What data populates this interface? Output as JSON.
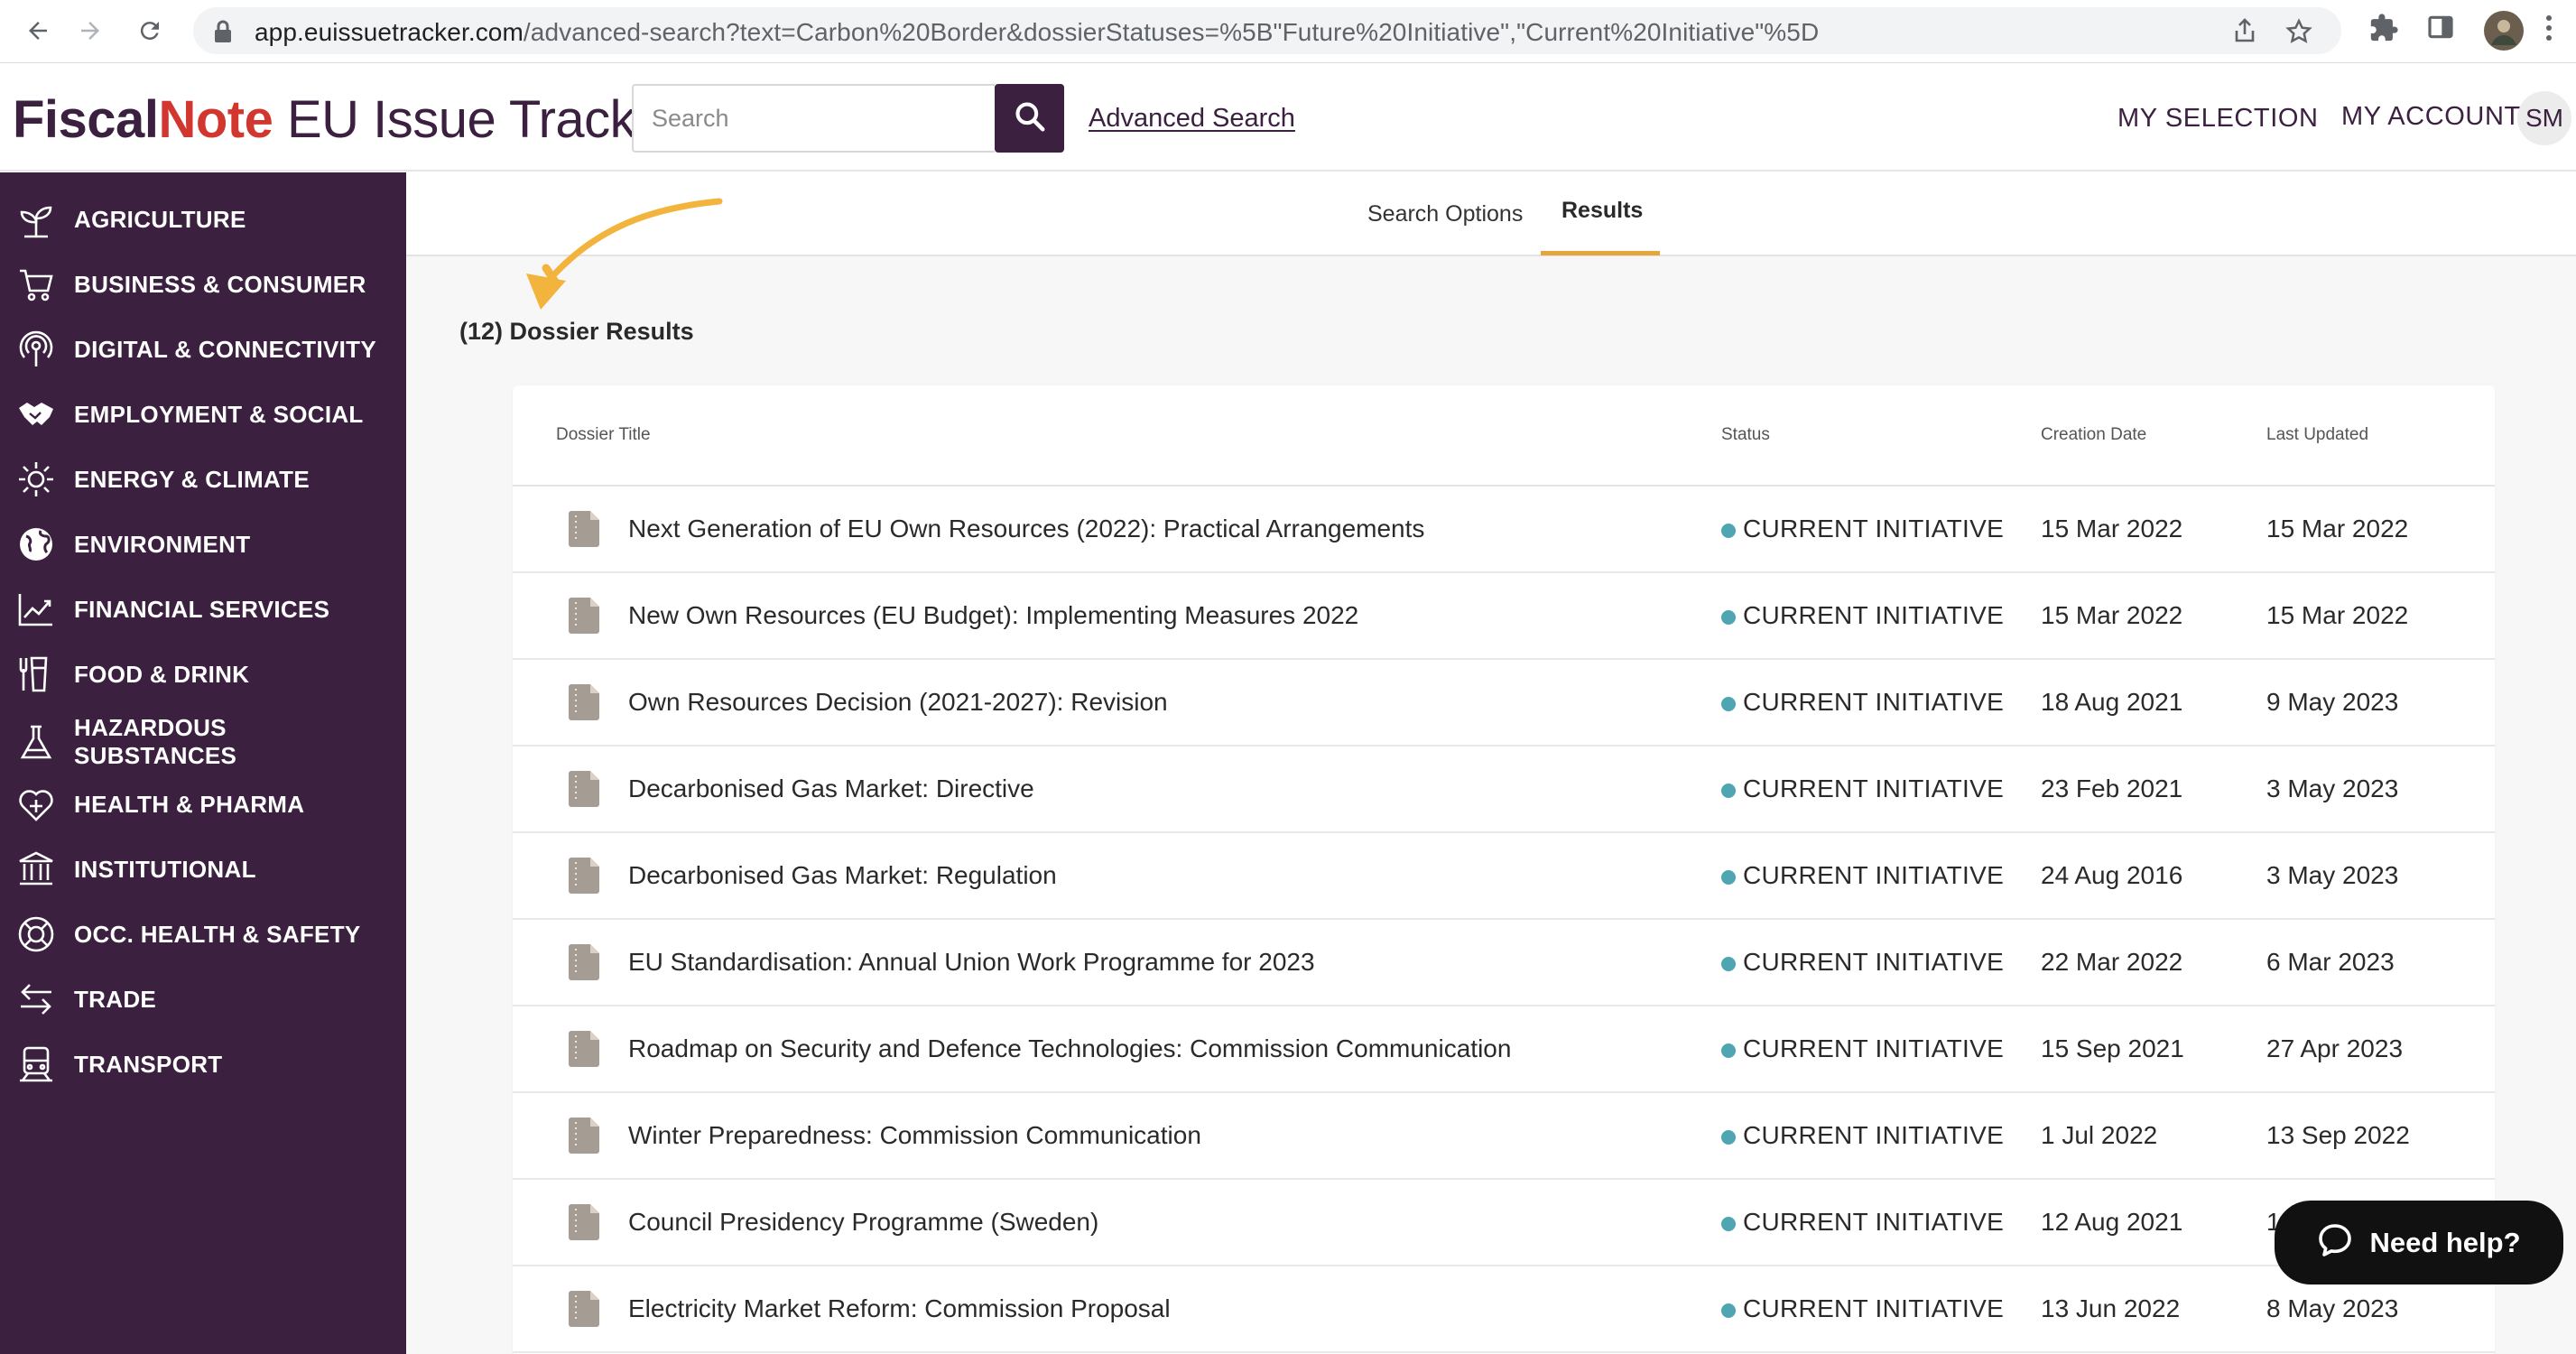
{
  "browser": {
    "url_host": "app.euissuetracker.com",
    "url_path": "/advanced-search?text=Carbon%20Border&dossierStatuses=%5B\"Future%20Initiative\",\"Current%20Initiative\"%5D"
  },
  "header": {
    "logo_brand_part1": "Fiscal",
    "logo_brand_part2": "Note",
    "logo_product": " EU Issue Tracker",
    "search_placeholder": "Search",
    "advanced_search": "Advanced Search",
    "my_selection": "MY SELECTION",
    "my_account": "MY ACCOUNT",
    "avatar_initials": "SM"
  },
  "sidebar": {
    "items": [
      {
        "label": "AGRICULTURE",
        "icon": "sprout-icon"
      },
      {
        "label": "BUSINESS & CONSUMER",
        "icon": "cart-icon"
      },
      {
        "label": "DIGITAL & CONNECTIVITY",
        "icon": "broadcast-icon"
      },
      {
        "label": "EMPLOYMENT & SOCIAL",
        "icon": "handshake-icon"
      },
      {
        "label": "ENERGY & CLIMATE",
        "icon": "sun-icon"
      },
      {
        "label": "ENVIRONMENT",
        "icon": "globe-icon"
      },
      {
        "label": "FINANCIAL SERVICES",
        "icon": "chart-icon"
      },
      {
        "label": "FOOD & DRINK",
        "icon": "utensils-icon"
      },
      {
        "label": "HAZARDOUS\nSUBSTANCES",
        "icon": "flask-icon"
      },
      {
        "label": "HEALTH & PHARMA",
        "icon": "heart-plus-icon"
      },
      {
        "label": "INSTITUTIONAL",
        "icon": "building-icon"
      },
      {
        "label": "OCC. HEALTH & SAFETY",
        "icon": "lifebuoy-icon"
      },
      {
        "label": "TRADE",
        "icon": "exchange-icon"
      },
      {
        "label": "TRANSPORT",
        "icon": "train-icon"
      }
    ]
  },
  "tabs": {
    "search_options": "Search Options",
    "results": "Results"
  },
  "results": {
    "count_label": "(12) Dossier Results"
  },
  "table": {
    "headers": {
      "title": "Dossier Title",
      "status": "Status",
      "created": "Creation Date",
      "updated": "Last Updated"
    },
    "status_color": "#4fa6b3",
    "rows": [
      {
        "title": "Next Generation of EU Own Resources (2022): Practical Arrangements",
        "status": "CURRENT INITIATIVE",
        "created": "15 Mar 2022",
        "updated": "15 Mar 2022"
      },
      {
        "title": "New Own Resources (EU Budget): Implementing Measures 2022",
        "status": "CURRENT INITIATIVE",
        "created": "15 Mar 2022",
        "updated": "15 Mar 2022"
      },
      {
        "title": "Own Resources Decision (2021-2027): Revision",
        "status": "CURRENT INITIATIVE",
        "created": "18 Aug 2021",
        "updated": "9 May 2023"
      },
      {
        "title": "Decarbonised Gas Market: Directive",
        "status": "CURRENT INITIATIVE",
        "created": "23 Feb 2021",
        "updated": "3 May 2023"
      },
      {
        "title": "Decarbonised Gas Market: Regulation",
        "status": "CURRENT INITIATIVE",
        "created": "24 Aug 2016",
        "updated": "3 May 2023"
      },
      {
        "title": "EU Standardisation: Annual Union Work Programme for 2023",
        "status": "CURRENT INITIATIVE",
        "created": "22 Mar 2022",
        "updated": "6 Mar 2023"
      },
      {
        "title": "Roadmap on Security and Defence Technologies: Commission Communication",
        "status": "CURRENT INITIATIVE",
        "created": "15 Sep 2021",
        "updated": "27 Apr 2023"
      },
      {
        "title": "Winter Preparedness: Commission Communication",
        "status": "CURRENT INITIATIVE",
        "created": "1 Jul 2022",
        "updated": "13 Sep 2022"
      },
      {
        "title": "Council Presidency Programme (Sweden)",
        "status": "CURRENT INITIATIVE",
        "created": "12 Aug 2021",
        "updated": "1"
      },
      {
        "title": "Electricity Market Reform: Commission Proposal",
        "status": "CURRENT INITIATIVE",
        "created": "13 Jun 2022",
        "updated": "8 May 2023"
      }
    ]
  },
  "help": {
    "label": "Need help?",
    "icon": "chat-bubble-icon"
  },
  "colors": {
    "brand_purple": "#3b2040",
    "brand_red": "#d1362f",
    "tab_accent": "#e5a73a",
    "annotation_arrow": "#f2b43c"
  }
}
